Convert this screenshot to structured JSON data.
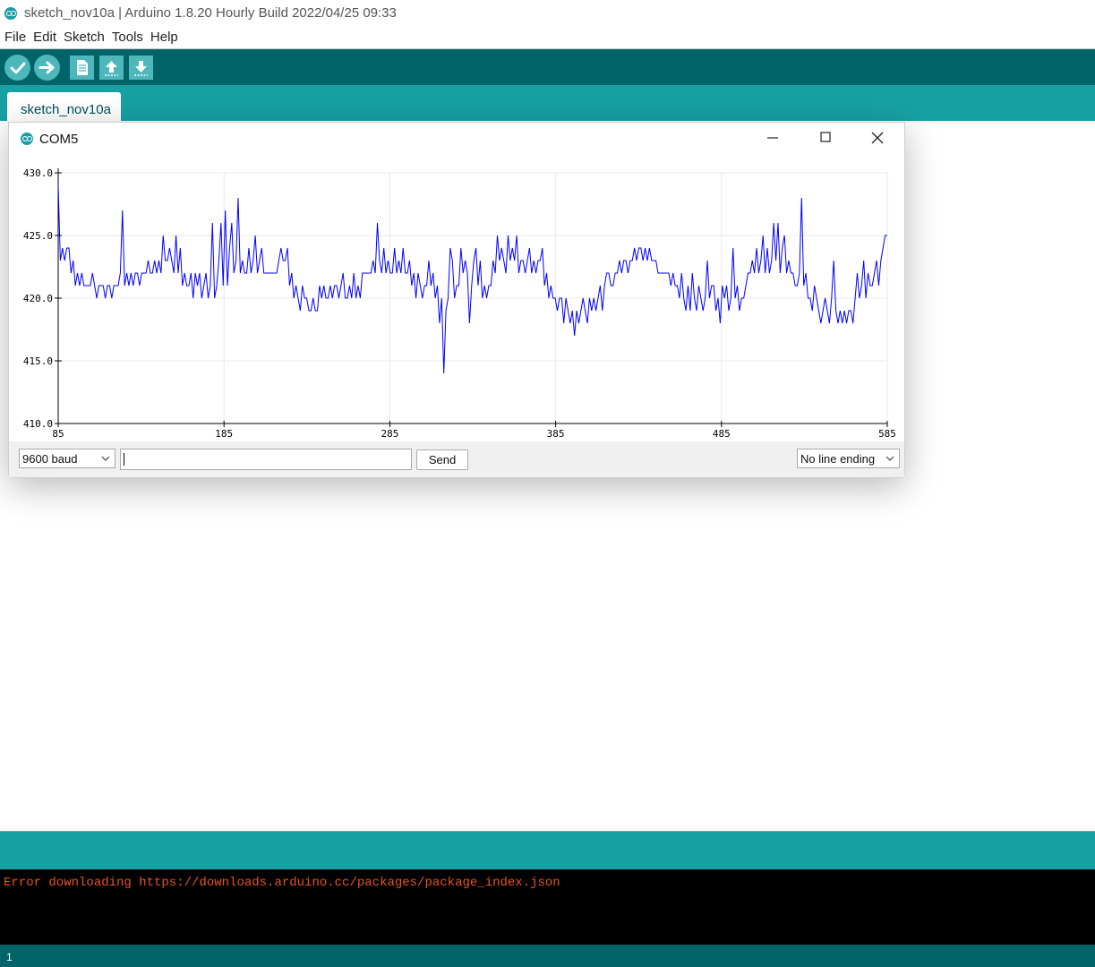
{
  "window": {
    "title": "sketch_nov10a | Arduino 1.8.20 Hourly Build 2022/04/25 09:33"
  },
  "menu": [
    "File",
    "Edit",
    "Sketch",
    "Tools",
    "Help"
  ],
  "toolbar": {
    "buttons": [
      "verify",
      "upload",
      "new",
      "open",
      "save"
    ]
  },
  "tabs": [
    {
      "label": "sketch_nov10a"
    }
  ],
  "console": {
    "message": "Error downloading https://downloads.arduino.cc/packages/package_index.json"
  },
  "footer": {
    "line": "1"
  },
  "plotter": {
    "title": "COM5",
    "baud": "9600 baud",
    "input_value": "",
    "send_label": "Send",
    "line_ending": "No line ending"
  },
  "colors": {
    "teal_dark": "#006468",
    "teal": "#17a1a5",
    "plot_line": "#0000ff",
    "console_error": "#e8541e"
  },
  "chart_data": {
    "type": "line",
    "xlim": [
      85,
      585
    ],
    "ylim": [
      410,
      430
    ],
    "xticks": [
      85,
      185,
      285,
      385,
      485,
      585
    ],
    "xtick_labels": [
      "85",
      "185",
      "285",
      "385",
      "485",
      "585"
    ],
    "yticks": [
      410,
      415,
      420,
      425,
      430
    ],
    "ytick_labels": [
      "410.0",
      "415.0",
      "420.0",
      "425.0",
      "430.0"
    ],
    "grid": true,
    "series": [
      {
        "color": "#0000ff",
        "values": [
          429,
          423,
          424,
          423,
          424,
          424,
          422,
          423,
          421,
          422,
          421,
          422,
          421,
          421,
          421,
          421,
          422,
          421,
          420,
          421,
          421,
          421,
          420,
          421,
          421,
          420,
          421,
          421,
          421,
          422,
          427,
          421,
          422,
          421,
          422,
          421,
          422,
          422,
          421,
          422,
          422,
          422,
          423,
          422,
          422,
          423,
          422,
          423,
          422,
          425,
          423,
          423,
          424,
          423,
          422,
          425,
          422,
          424,
          421,
          422,
          421,
          421,
          422,
          420,
          422,
          421,
          422,
          420,
          421,
          422,
          420,
          421,
          426,
          420,
          421,
          423,
          426,
          421,
          427,
          421,
          424,
          426,
          422,
          423,
          428,
          422,
          423,
          422,
          422,
          424,
          422,
          423,
          425,
          422,
          423,
          424,
          422,
          422,
          422,
          422,
          422,
          422,
          422,
          423,
          424,
          423,
          423,
          424,
          421,
          422,
          420,
          421,
          420,
          419,
          421,
          420,
          420,
          419,
          419,
          420,
          419,
          419,
          421,
          420,
          421,
          420,
          420,
          421,
          420,
          421,
          421,
          420,
          421,
          422,
          420,
          420,
          421,
          420,
          422,
          420,
          421,
          420,
          422,
          422,
          422,
          422,
          422,
          423,
          422,
          426,
          423,
          422,
          424,
          422,
          423,
          422,
          422,
          424,
          422,
          423,
          422,
          424,
          422,
          422,
          423,
          421,
          422,
          420,
          422,
          421,
          420,
          421,
          421,
          423,
          421,
          422,
          420,
          421,
          418,
          420,
          414,
          419,
          420,
          424,
          423,
          420,
          421,
          421,
          424,
          422,
          423,
          422,
          418,
          421,
          423,
          424,
          421,
          423,
          420,
          421,
          420,
          421,
          421,
          423,
          422,
          425,
          423,
          424,
          423,
          422,
          425,
          423,
          424,
          423,
          425,
          422,
          423,
          423,
          422,
          423,
          424,
          422,
          423,
          422,
          423,
          423,
          424,
          421,
          422,
          420,
          421,
          420,
          420,
          419,
          420,
          420,
          418,
          420,
          419,
          418,
          419,
          417,
          419,
          418,
          419,
          420,
          419,
          418,
          420,
          419,
          420,
          419,
          420,
          421,
          419,
          421,
          422,
          422,
          421,
          421,
          422,
          422,
          423,
          422,
          423,
          423,
          422,
          423,
          423,
          424,
          423,
          424,
          424,
          423,
          424,
          423,
          424,
          423,
          423,
          423,
          422,
          422,
          422,
          422,
          422,
          422,
          421,
          422,
          421,
          421,
          420,
          422,
          420,
          419,
          421,
          419,
          422,
          420,
          419,
          421,
          420,
          419,
          420,
          423,
          420,
          421,
          421,
          419,
          420,
          418,
          421,
          420,
          421,
          419,
          420,
          424,
          420,
          421,
          419,
          420,
          420,
          421,
          422,
          422,
          423,
          422,
          424,
          422,
          423,
          425,
          422,
          424,
          422,
          423,
          426,
          423,
          426,
          422,
          424,
          425,
          422,
          423,
          422,
          422,
          421,
          421,
          422,
          428,
          421,
          422,
          420,
          420,
          419,
          421,
          420,
          419,
          418,
          419,
          420,
          419,
          418,
          420,
          423,
          419,
          418,
          419,
          418,
          419,
          418,
          419,
          419,
          418,
          420,
          422,
          420,
          421,
          423,
          420,
          422,
          421,
          421,
          422,
          423,
          421,
          423,
          424,
          425,
          425
        ]
      }
    ]
  }
}
